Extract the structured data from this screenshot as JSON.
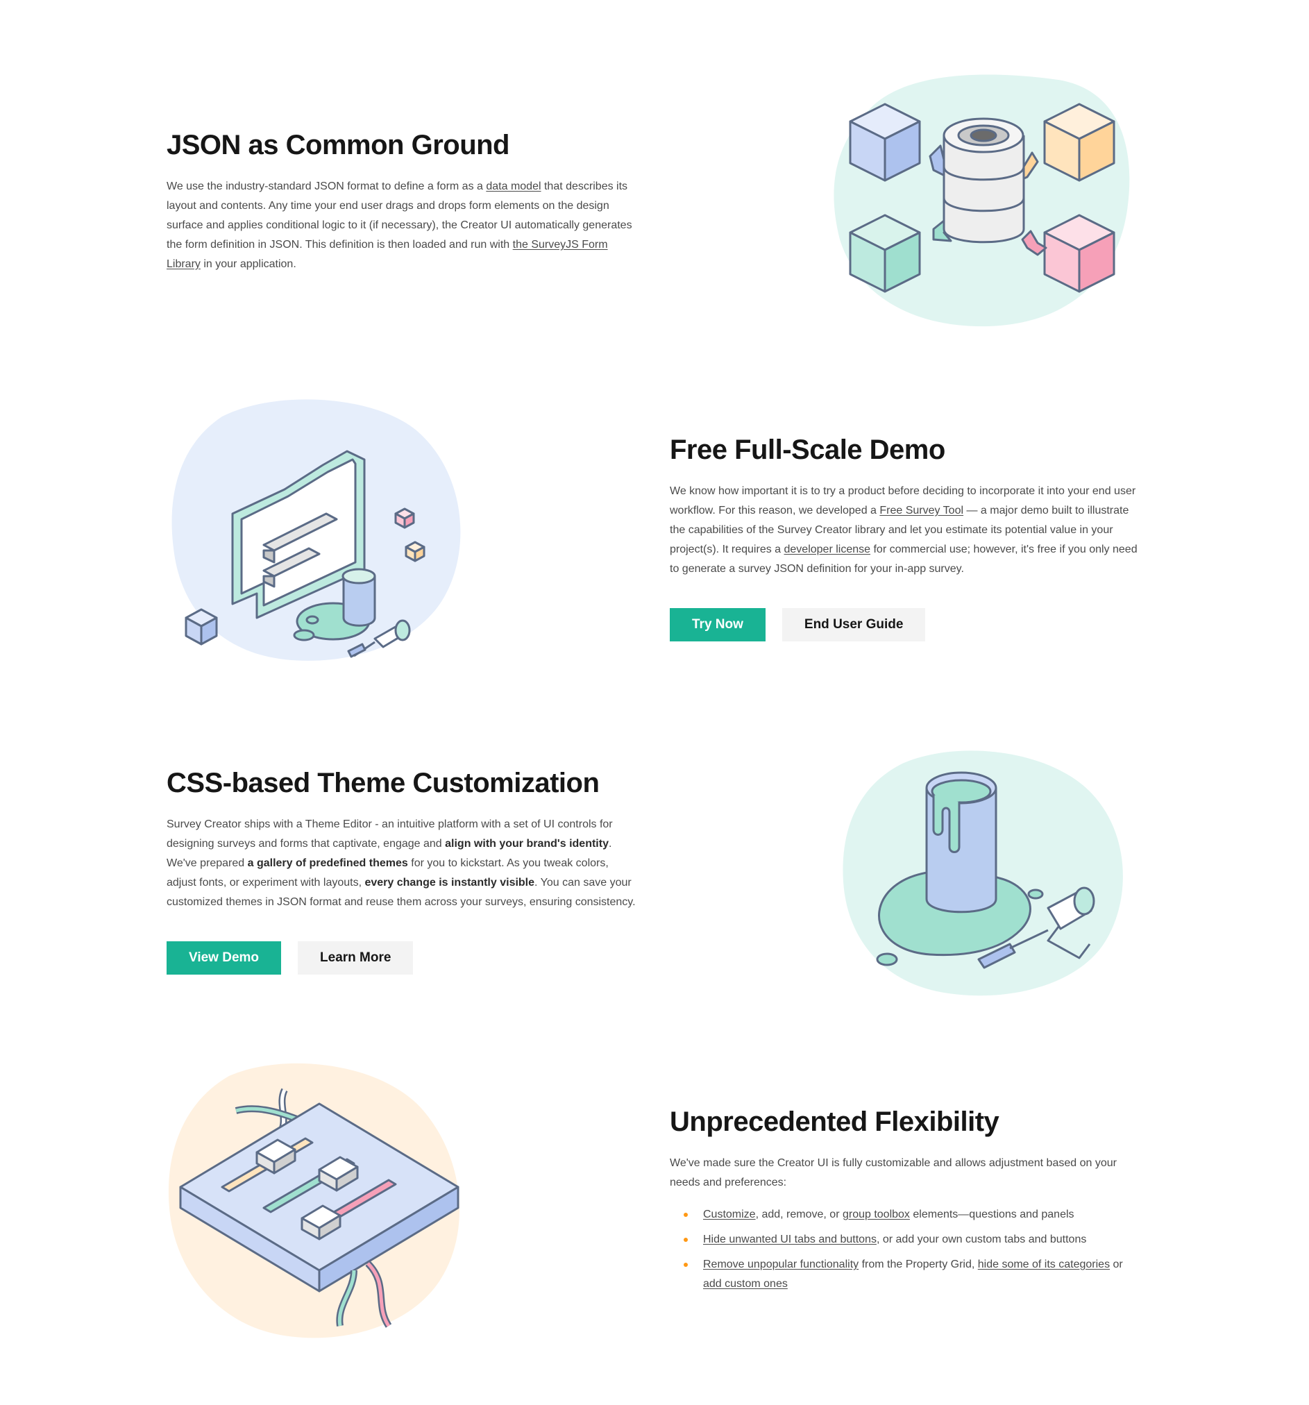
{
  "sections": {
    "json": {
      "title": "JSON as Common Ground",
      "p1": "We use the industry-standard JSON format to define a form as a ",
      "link1": "data model",
      "p2": " that describes its layout and contents. Any time your end user drags and drops form elements on the design surface and applies conditional logic to it (if necessary), the Creator UI automatically generates the form definition in JSON. This definition is then loaded and run with ",
      "link2": "the SurveyJS Form Library",
      "p3": " in your application."
    },
    "demo": {
      "title": "Free Full-Scale Demo",
      "p1": "We know how important it is to try a product before deciding to incorporate it into your end user workflow. For this reason, we developed a ",
      "link1": "Free Survey Tool",
      "p2": " — a major demo built to illustrate the capabilities of the Survey Creator library and let you estimate its potential value in your project(s). It requires a ",
      "link2": "developer license",
      "p3": " for commercial use; however, it's free if you only need to generate a survey JSON definition for your in-app survey.",
      "primary_button": "Try Now",
      "secondary_button": "End User Guide"
    },
    "theme": {
      "title": "CSS-based Theme Customization",
      "p1": "Survey Creator ships with a Theme Editor - an intuitive platform with a set of UI controls for designing surveys and forms that captivate, engage and ",
      "b1": "align with your brand's identity",
      "p2": ". We've prepared ",
      "b2": "a gallery of predefined themes",
      "p3": " for you to kickstart. As you tweak colors, adjust fonts, or experiment with layouts, ",
      "b3": "every change is instantly visible",
      "p4": ". You can save your customized themes in JSON format and reuse them across your surveys, ensuring consistency.",
      "primary_button": "View Demo",
      "secondary_button": "Learn More"
    },
    "flex": {
      "title": "Unprecedented Flexibility",
      "intro": "We've made sure the Creator UI is fully customizable and allows adjustment based on your needs and preferences:",
      "items": [
        {
          "l1": "Customize",
          "t1": ", add, remove, or ",
          "l2": "group toolbox",
          "t2": " elements—questions and panels"
        },
        {
          "l1": "Hide unwanted UI tabs and buttons",
          "t1": ", or add your own custom tabs and buttons"
        },
        {
          "l1": "Remove unpopular functionality",
          "t1": " from the Property Grid, ",
          "l2": "hide some of its categories",
          "t2": " or ",
          "l3": "add custom ones"
        }
      ]
    }
  },
  "colors": {
    "accent": "#19b394",
    "bullet": "#ff9814",
    "mint_blob": "#e0f5f1",
    "blue_blob": "#e6eefb",
    "peach_blob": "#fff1e0"
  },
  "icons": [
    "database-icon",
    "chat-bubble-icon",
    "paint-bucket-icon",
    "paint-roller-icon",
    "mixer-board-icon",
    "cube-icon"
  ]
}
